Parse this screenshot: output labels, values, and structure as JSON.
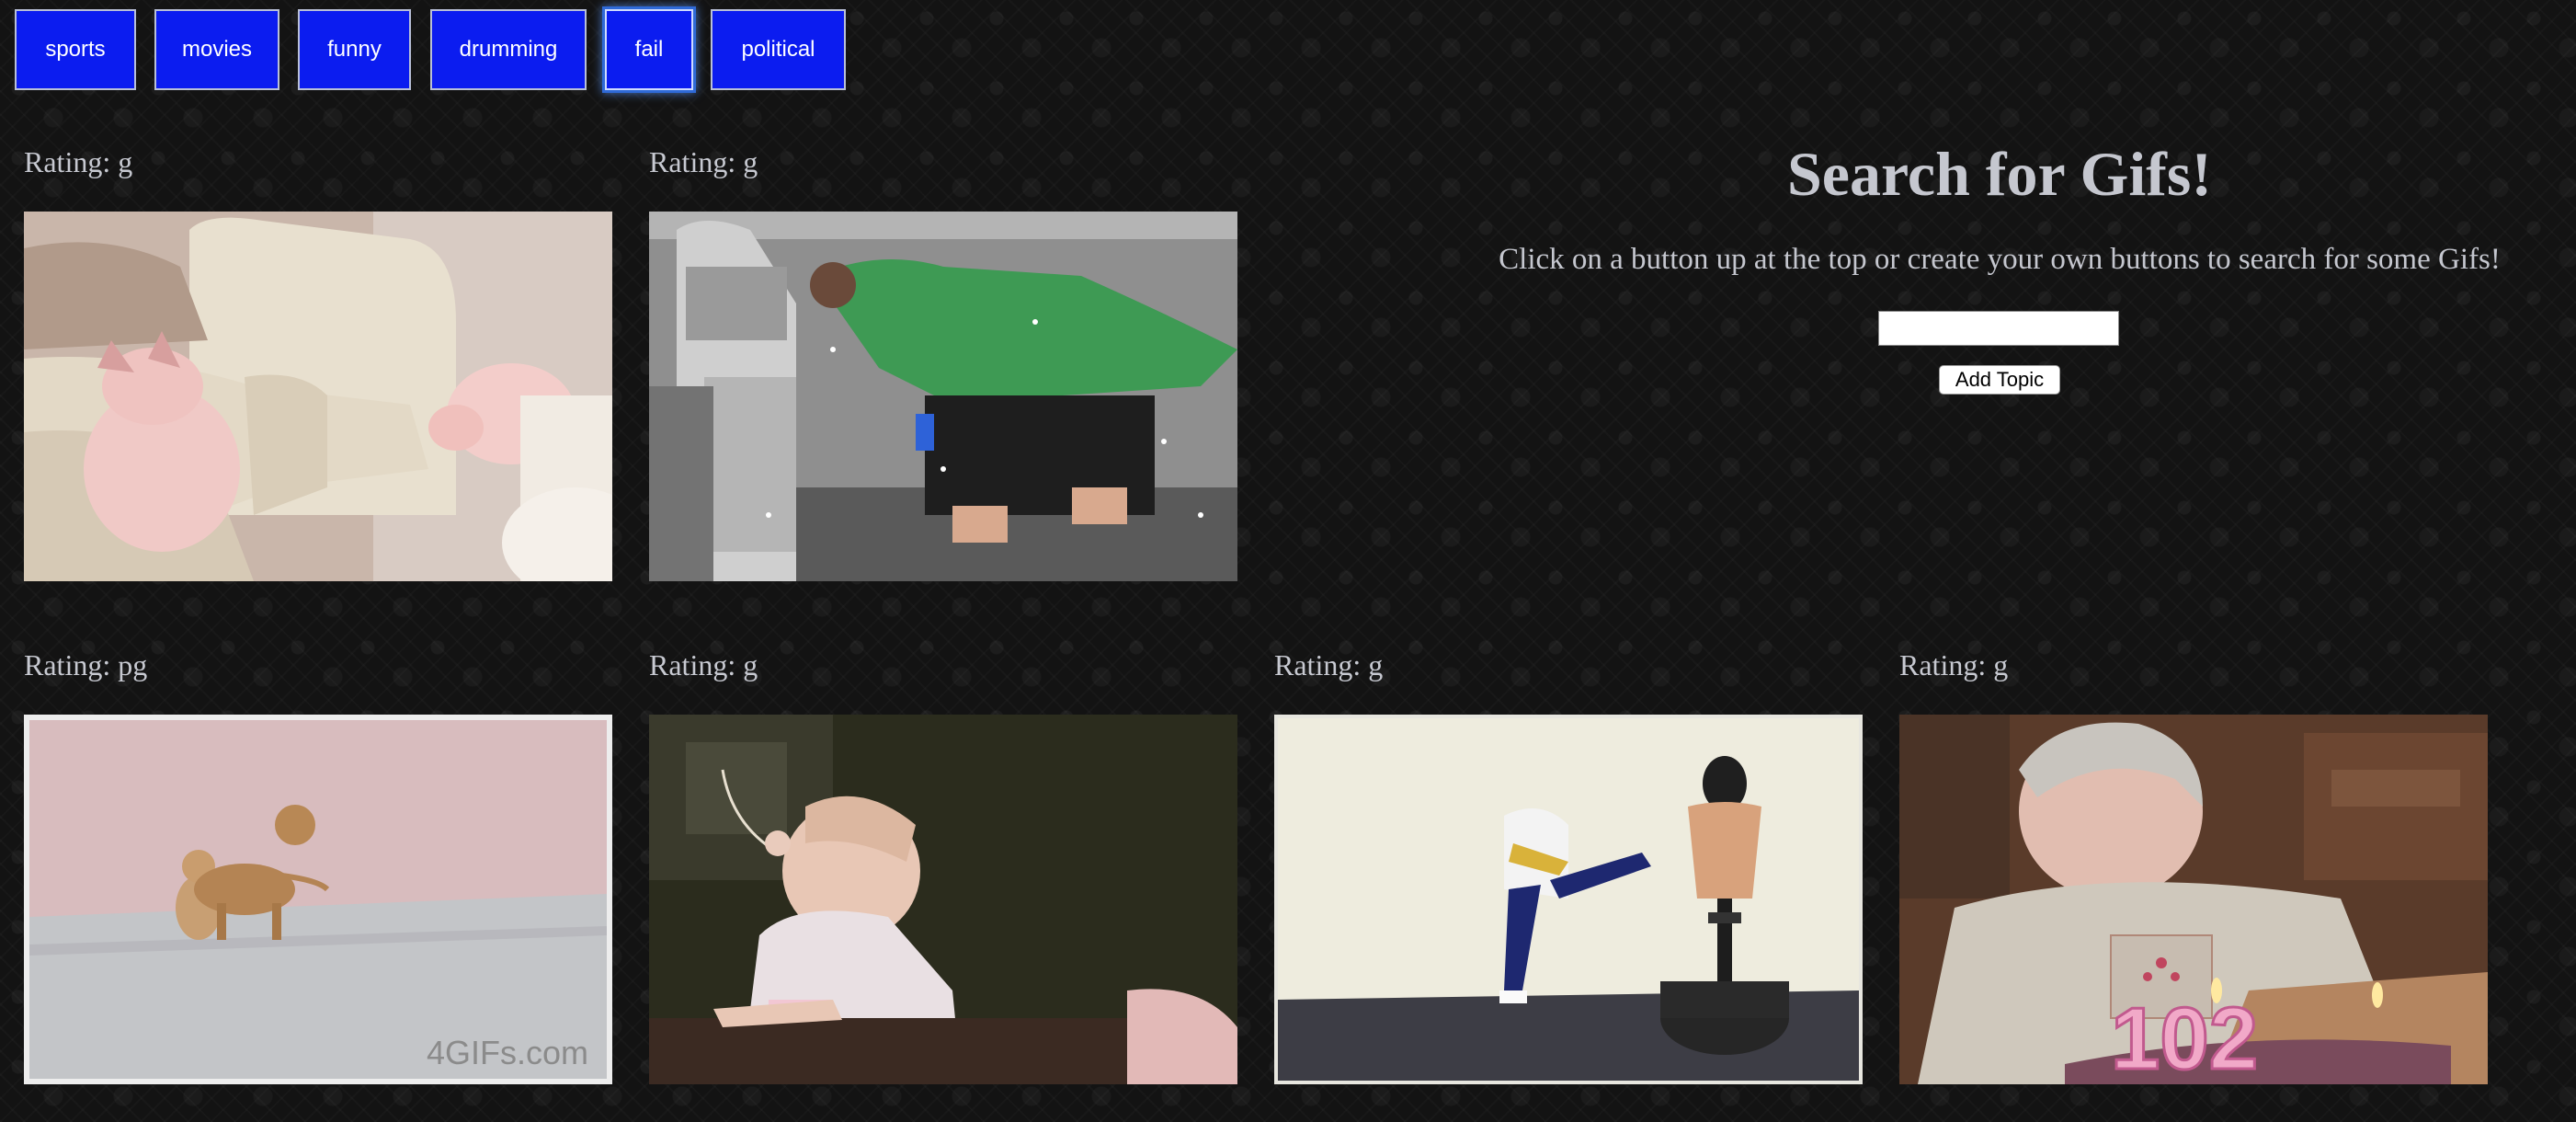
{
  "topics": [
    {
      "label": "sports",
      "active": false
    },
    {
      "label": "movies",
      "active": false
    },
    {
      "label": "funny",
      "active": false
    },
    {
      "label": "drumming",
      "active": false
    },
    {
      "label": "fail",
      "active": true
    },
    {
      "label": "political",
      "active": false
    }
  ],
  "gifs": [
    {
      "rating": "Rating: g",
      "subject": "two pink pigs on a beige couch"
    },
    {
      "rating": "Rating: g",
      "subject": "person in green shirt at an ATM"
    },
    {
      "rating": "Rating: pg",
      "subject": "two small chihuahuas by a pink wall"
    },
    {
      "rating": "Rating: g",
      "subject": "baby at a table with a string"
    },
    {
      "rating": "Rating: g",
      "subject": "kid kicking a punching bag dummy"
    },
    {
      "rating": "Rating: g",
      "subject": "elderly woman with 102 birthday candles"
    }
  ],
  "search": {
    "title": "Search for Gifs!",
    "help_text": "Click on a button up at the top or create your own buttons to search for some Gifs!",
    "input_value": "",
    "add_button": "Add Topic"
  },
  "watermark": "4GIFs.com",
  "cake_number": "102",
  "colors": {
    "button_blue": "#0b1cf0",
    "background": "#131313",
    "text": "#c7c9d1"
  }
}
